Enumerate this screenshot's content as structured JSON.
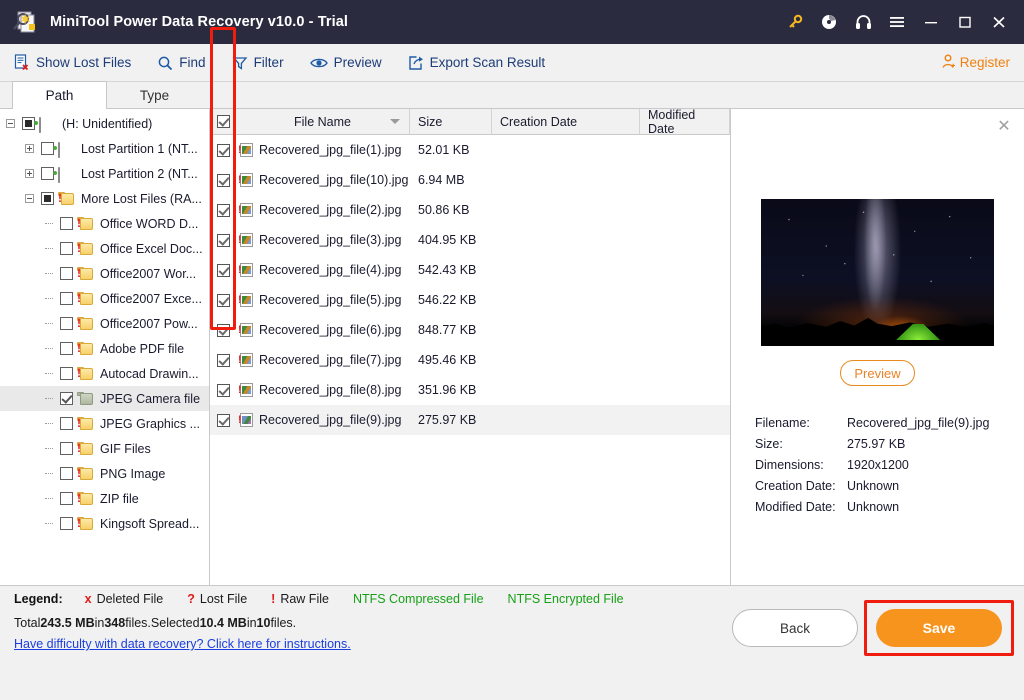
{
  "window": {
    "title": "MiniTool Power Data Recovery v10.0 - Trial",
    "app_icon": "magnifier-documents-icon",
    "controls": [
      {
        "name": "key-icon",
        "glyph": "key"
      },
      {
        "name": "disc-icon",
        "glyph": "disc"
      },
      {
        "name": "headphones-icon",
        "glyph": "headphones"
      },
      {
        "name": "menu-icon",
        "glyph": "hamburger"
      },
      {
        "name": "minimize-button",
        "glyph": "minimize"
      },
      {
        "name": "maximize-button",
        "glyph": "maximize"
      },
      {
        "name": "close-button",
        "glyph": "close"
      }
    ],
    "accent_orange": "#f7941d",
    "titlebar_bg": "#2b2b40",
    "link_blue": "#1a3ee0",
    "highlight_red": "#f01c0e"
  },
  "toolbar": {
    "items": [
      {
        "label": "Show Lost Files",
        "icon": "document-with-x-icon"
      },
      {
        "label": "Find",
        "icon": "search-icon"
      },
      {
        "label": "Filter",
        "icon": "funnel-icon"
      },
      {
        "label": "Preview",
        "icon": "eye-icon"
      },
      {
        "label": "Export Scan Result",
        "icon": "export-icon"
      }
    ],
    "register": {
      "label": "Register",
      "icon": "user-plus-icon"
    }
  },
  "tabs": [
    {
      "label": "Path",
      "active": true
    },
    {
      "label": "Type",
      "active": false
    }
  ],
  "tree": {
    "nodes": [
      {
        "label": "(H: Unidentified)",
        "indent": 0,
        "expander": "minus",
        "check": "partial",
        "icon": "drive-icon",
        "selected": false
      },
      {
        "label": "Lost Partition 1 (NT...",
        "indent": 1,
        "expander": "plus",
        "check": "off",
        "icon": "drive-icon",
        "selected": false
      },
      {
        "label": "Lost Partition 2 (NT...",
        "indent": 1,
        "expander": "plus",
        "check": "off",
        "icon": "drive-icon",
        "selected": false
      },
      {
        "label": "More Lost Files (RA...",
        "indent": 1,
        "expander": "minus",
        "check": "partial",
        "icon": "folder-raw-icon",
        "selected": false
      },
      {
        "label": "Office WORD D...",
        "indent": 2,
        "expander": "none",
        "check": "off",
        "icon": "folder-raw-icon",
        "selected": false
      },
      {
        "label": "Office Excel Doc...",
        "indent": 2,
        "expander": "none",
        "check": "off",
        "icon": "folder-raw-icon",
        "selected": false
      },
      {
        "label": "Office2007 Wor...",
        "indent": 2,
        "expander": "none",
        "check": "off",
        "icon": "folder-raw-icon",
        "selected": false
      },
      {
        "label": "Office2007 Exce...",
        "indent": 2,
        "expander": "none",
        "check": "off",
        "icon": "folder-raw-icon",
        "selected": false
      },
      {
        "label": "Office2007 Pow...",
        "indent": 2,
        "expander": "none",
        "check": "off",
        "icon": "folder-raw-icon",
        "selected": false
      },
      {
        "label": "Adobe PDF file",
        "indent": 2,
        "expander": "none",
        "check": "off",
        "icon": "folder-raw-icon",
        "selected": false
      },
      {
        "label": "Autocad Drawin...",
        "indent": 2,
        "expander": "none",
        "check": "off",
        "icon": "folder-raw-icon",
        "selected": false
      },
      {
        "label": "JPEG Camera file",
        "indent": 2,
        "expander": "none",
        "check": "on",
        "icon": "folder-selected-icon",
        "selected": true
      },
      {
        "label": "JPEG Graphics ...",
        "indent": 2,
        "expander": "none",
        "check": "off",
        "icon": "folder-raw-icon",
        "selected": false
      },
      {
        "label": "GIF Files",
        "indent": 2,
        "expander": "none",
        "check": "off",
        "icon": "folder-raw-icon",
        "selected": false
      },
      {
        "label": "PNG Image",
        "indent": 2,
        "expander": "none",
        "check": "off",
        "icon": "folder-raw-icon",
        "selected": false
      },
      {
        "label": "ZIP file",
        "indent": 2,
        "expander": "none",
        "check": "off",
        "icon": "folder-raw-icon",
        "selected": false
      },
      {
        "label": "Kingsoft Spread...",
        "indent": 2,
        "expander": "none",
        "check": "off",
        "icon": "folder-raw-icon",
        "selected": false
      }
    ]
  },
  "filelist": {
    "columns": [
      "File Name",
      "Size",
      "Creation Date",
      "Modified Date"
    ],
    "header_checkbox": "on",
    "sort_column": "File Name",
    "rows": [
      {
        "name": "Recovered_jpg_file(1).jpg",
        "size": "52.01 KB",
        "creation": "",
        "modified": "",
        "checked": true,
        "selected": false
      },
      {
        "name": "Recovered_jpg_file(10).jpg",
        "size": "6.94 MB",
        "creation": "",
        "modified": "",
        "checked": true,
        "selected": false
      },
      {
        "name": "Recovered_jpg_file(2).jpg",
        "size": "50.86 KB",
        "creation": "",
        "modified": "",
        "checked": true,
        "selected": false
      },
      {
        "name": "Recovered_jpg_file(3).jpg",
        "size": "404.95 KB",
        "creation": "",
        "modified": "",
        "checked": true,
        "selected": false
      },
      {
        "name": "Recovered_jpg_file(4).jpg",
        "size": "542.43 KB",
        "creation": "",
        "modified": "",
        "checked": true,
        "selected": false
      },
      {
        "name": "Recovered_jpg_file(5).jpg",
        "size": "546.22 KB",
        "creation": "",
        "modified": "",
        "checked": true,
        "selected": false
      },
      {
        "name": "Recovered_jpg_file(6).jpg",
        "size": "848.77 KB",
        "creation": "",
        "modified": "",
        "checked": true,
        "selected": false
      },
      {
        "name": "Recovered_jpg_file(7).jpg",
        "size": "495.46 KB",
        "creation": "",
        "modified": "",
        "checked": true,
        "selected": false
      },
      {
        "name": "Recovered_jpg_file(8).jpg",
        "size": "351.96 KB",
        "creation": "",
        "modified": "",
        "checked": true,
        "selected": false
      },
      {
        "name": "Recovered_jpg_file(9).jpg",
        "size": "275.97 KB",
        "creation": "",
        "modified": "",
        "checked": true,
        "selected": true
      }
    ]
  },
  "preview": {
    "close_icon": "close-icon",
    "thumbnail_alt": "night-sky-milky-way-with-green-tent",
    "button_label": "Preview",
    "meta": [
      {
        "key": "Filename:",
        "value": "Recovered_jpg_file(9).jpg"
      },
      {
        "key": "Size:",
        "value": "275.97 KB"
      },
      {
        "key": "Dimensions:",
        "value": "1920x1200"
      },
      {
        "key": "Creation Date:",
        "value": "Unknown"
      },
      {
        "key": "Modified Date:",
        "value": "Unknown"
      }
    ]
  },
  "legend": {
    "title": "Legend:",
    "items": [
      {
        "mark": "x",
        "label": "Deleted File",
        "color": "#e01b1b"
      },
      {
        "mark": "?",
        "label": "Lost File",
        "color": "#e01b1b"
      },
      {
        "mark": "!",
        "label": "Raw File",
        "color": "#e01b1b"
      },
      {
        "mark": "",
        "label": "NTFS Compressed File",
        "color": "#16a016"
      },
      {
        "mark": "",
        "label": "NTFS Encrypted File",
        "color": "#16a016"
      }
    ]
  },
  "status": {
    "total_prefix": "Total ",
    "total_size": "243.5 MB",
    "total_mid": " in ",
    "total_count": "348",
    "total_suffix": " files.",
    "selected_prefix": "  Selected ",
    "selected_size": "10.4 MB",
    "selected_mid": " in ",
    "selected_count": "10",
    "selected_suffix": " files.",
    "help_link": "Have difficulty with data recovery? Click here for instructions."
  },
  "buttons": {
    "back": "Back",
    "save": "Save"
  }
}
